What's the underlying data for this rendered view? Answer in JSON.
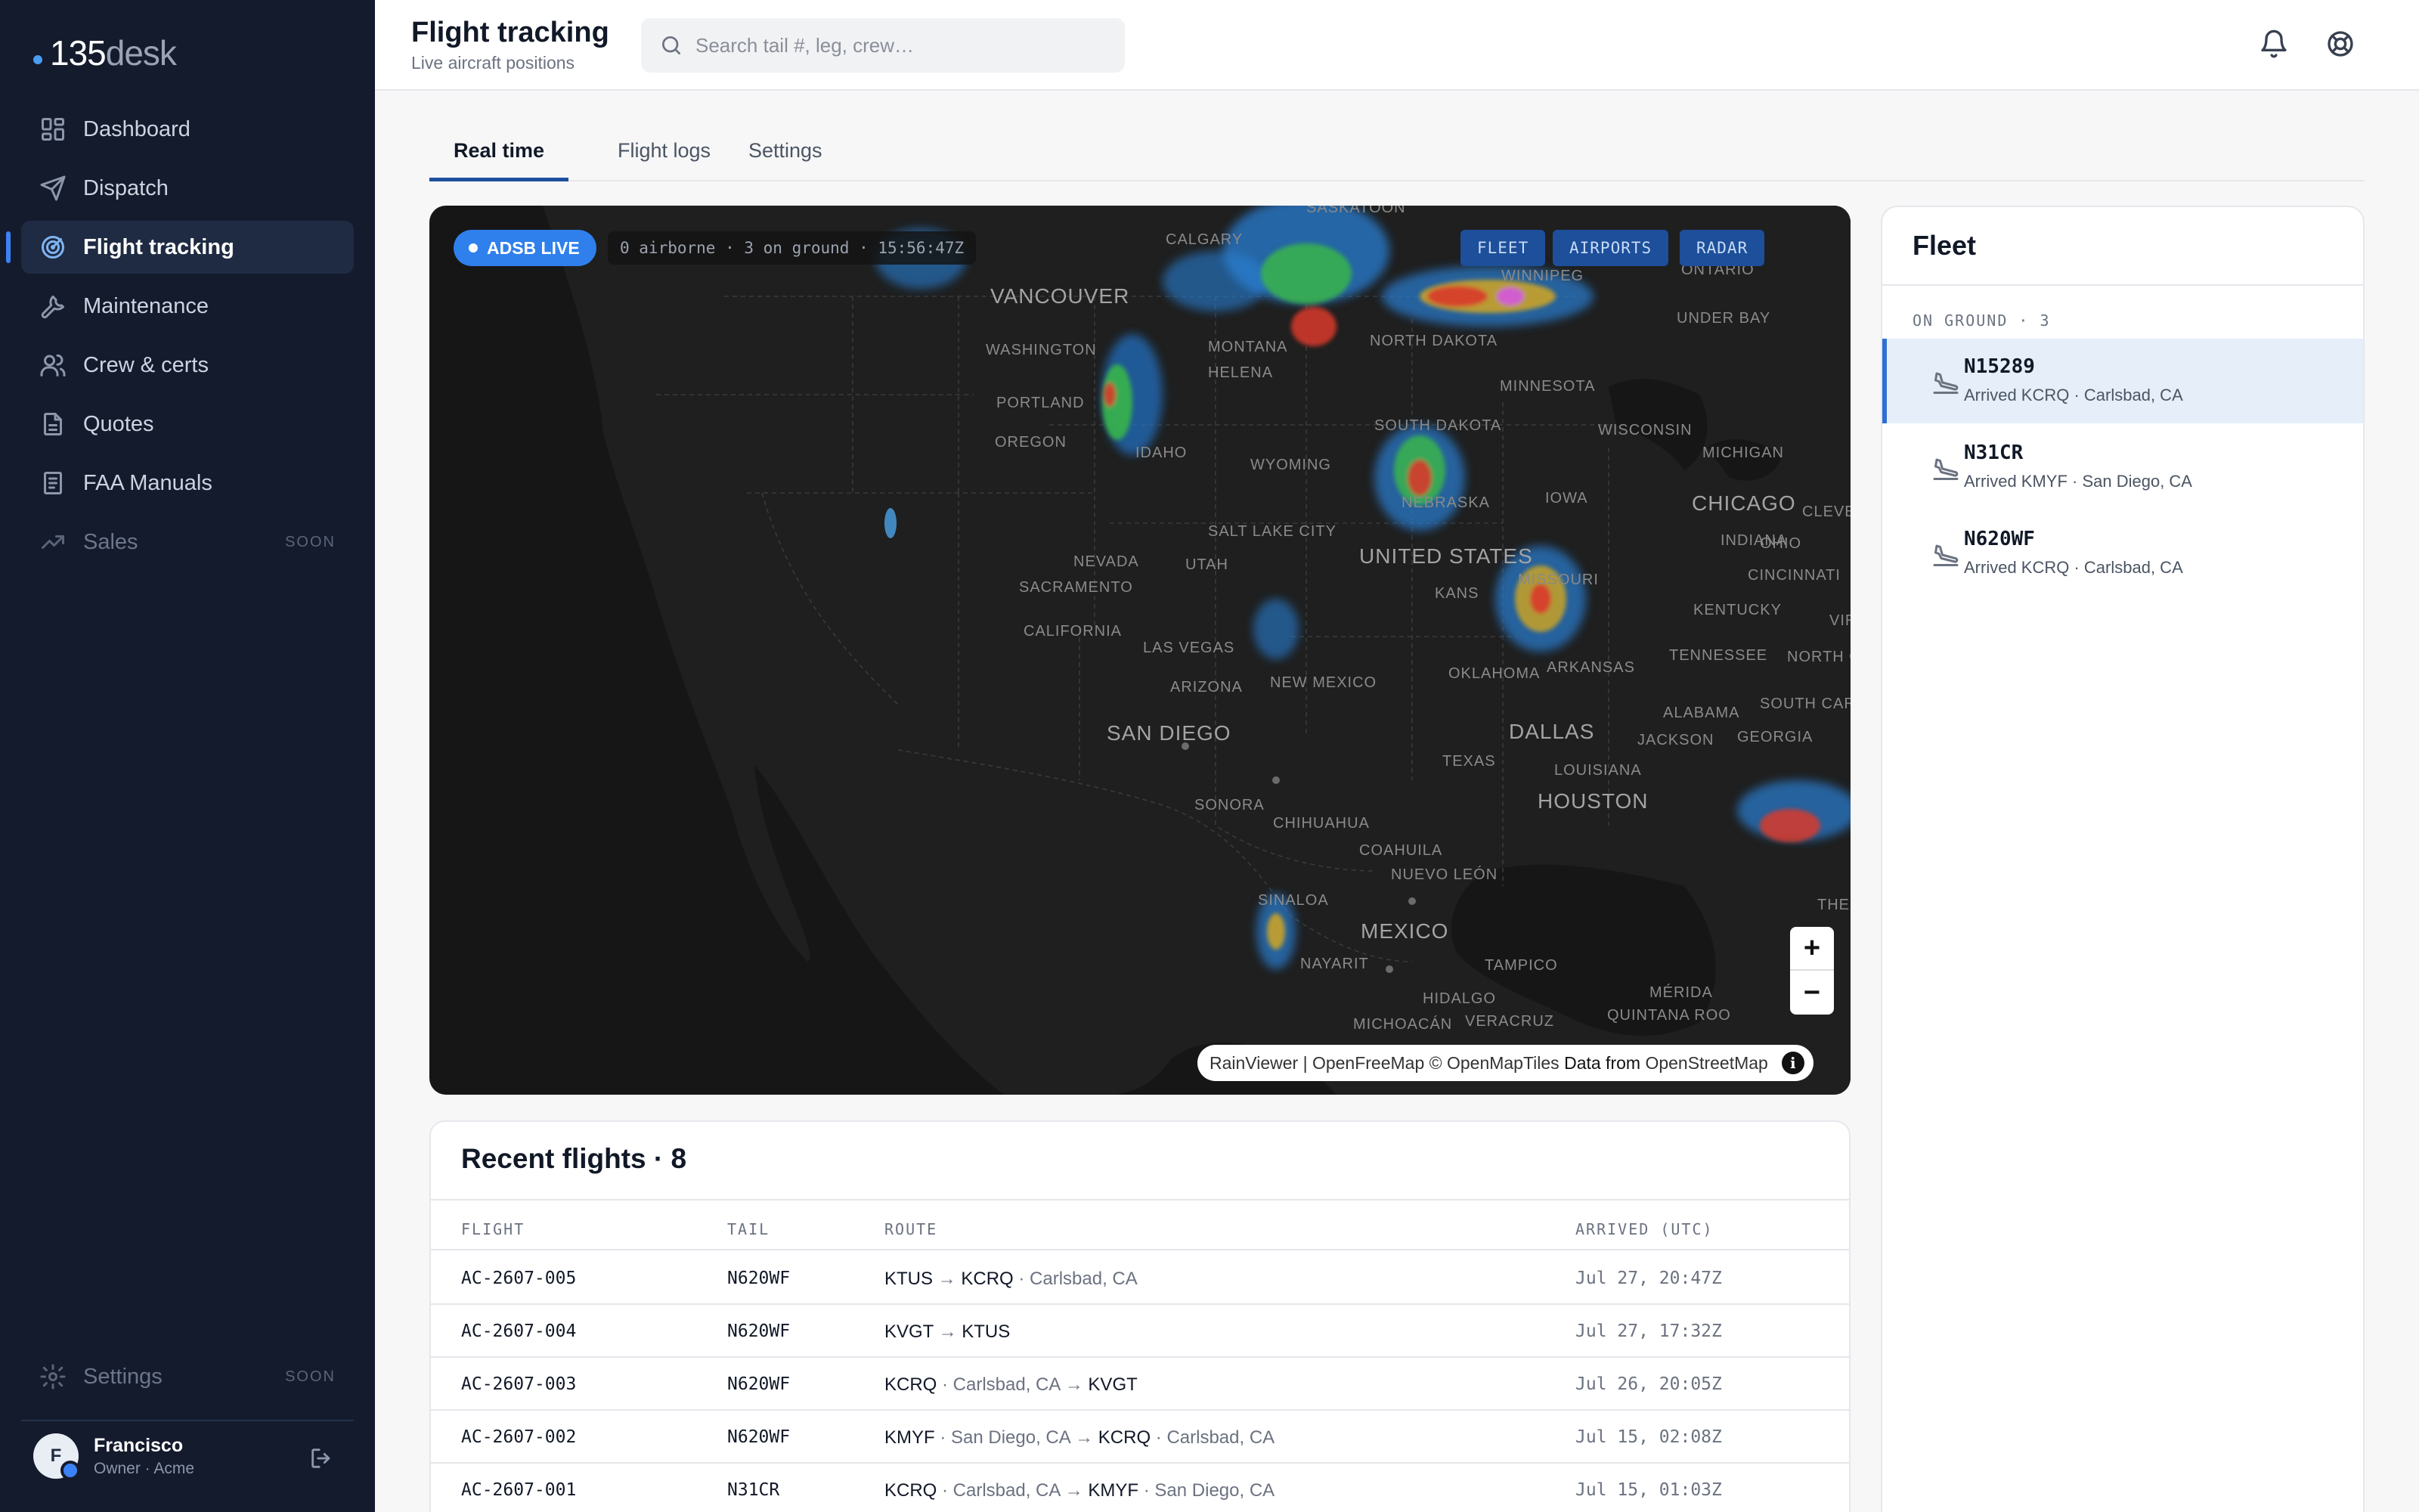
{
  "brand": {
    "number": "135",
    "word": "desk"
  },
  "sidebar": {
    "items": [
      {
        "label": "Dashboard"
      },
      {
        "label": "Dispatch"
      },
      {
        "label": "Flight tracking"
      },
      {
        "label": "Maintenance"
      },
      {
        "label": "Crew & certs"
      },
      {
        "label": "Quotes"
      },
      {
        "label": "FAA Manuals"
      },
      {
        "label": "Sales",
        "badge": "SOON"
      }
    ],
    "settings": {
      "label": "Settings",
      "badge": "SOON"
    },
    "user": {
      "initial": "F",
      "name": "Francisco",
      "role": "Owner · Acme"
    }
  },
  "header": {
    "title": "Flight tracking",
    "subtitle": "Live aircraft positions",
    "search_placeholder": "Search tail #, leg, crew…"
  },
  "tabs": [
    {
      "label": "Real time",
      "active": true
    },
    {
      "label": "Flight logs",
      "active": false
    },
    {
      "label": "Settings",
      "active": false
    }
  ],
  "map": {
    "live_label": "ADSB LIVE",
    "stats": "0 airborne · 3 on ground · 15:56:47Z",
    "layers": [
      "FLEET",
      "AIRPORTS",
      "RADAR"
    ],
    "zoom_in": "+",
    "zoom_out": "−",
    "attribution": {
      "sources": "RainViewer | OpenFreeMap © OpenMapTiles",
      "data_prefix": "Data from",
      "data_source": "OpenStreetMap",
      "info": "i"
    },
    "labels": {
      "saskatoon": "SASKATOON",
      "calgary": "CALGARY",
      "winnipeg": "WINNIPEG",
      "ontario": "ONTARIO",
      "vancouver": "VANCOUVER",
      "thunder_bay": "UNDER BAY",
      "washington": "WASHINGTON",
      "montana": "MONTANA",
      "helena": "HELENA",
      "north_dakota": "NORTH DAKOTA",
      "minnesota": "MINNESOTA",
      "portland": "PORTLAND",
      "oregon": "OREGON",
      "idaho": "IDAHO",
      "wyoming": "WYOMING",
      "south_dakota": "SOUTH DAKOTA",
      "wisconsin": "WISCONSIN",
      "michigan": "MICHIGAN",
      "nebraska": "NEBRASKA",
      "iowa": "IOWA",
      "chicago": "CHICAGO",
      "cleveland": "CLEVE",
      "salt_lake_city": "SALT LAKE CITY",
      "nevada": "NEVADA",
      "utah": "UTAH",
      "united_states": "UNITED STATES",
      "indiana": "INDIANA",
      "ohio": "OHIO",
      "sacramento": "SACRAMENTO",
      "kansas": "KANS",
      "missouri": "MISSOURI",
      "cincinnati": "CINCINNATI",
      "california": "CALIFORNIA",
      "kentucky": "KENTUCKY",
      "virginia": "VIR",
      "las_vegas": "LAS VEGAS",
      "arizona": "ARIZONA",
      "new_mexico": "NEW MEXICO",
      "oklahoma": "OKLAHOMA",
      "arkansas": "ARKANSAS",
      "tennessee": "TENNESSEE",
      "north_carolina": "NORTH C",
      "san_diego": "SAN DIEGO",
      "dallas": "DALLAS",
      "alabama": "ALABAMA",
      "jackson": "JACKSON",
      "south_carolina": "SOUTH CARO",
      "georgia": "GEORGIA",
      "texas": "TEXAS",
      "louisiana": "LOUISIANA",
      "houston": "HOUSTON",
      "sonora": "SONORA",
      "chihuahua": "CHIHUAHUA",
      "coahuila": "COAHUILA",
      "nuevo_leon": "NUEVO LEÓN",
      "sinaloa": "SINALOA",
      "mexico": "MEXICO",
      "the": "THE",
      "nayarit": "NAYARIT",
      "tampico": "TAMPICO",
      "hidalgo": "HIDALGO",
      "merida": "MÉRIDA",
      "michoacan": "MICHOACÁN",
      "veracruz": "VERACRUZ",
      "quintana_roo": "QUINTANA ROO"
    }
  },
  "flights": {
    "title": "Recent flights · 8",
    "columns": [
      "FLIGHT",
      "TAIL",
      "ROUTE",
      "ARRIVED (UTC)"
    ],
    "rows": [
      {
        "flight": "AC-2607-005",
        "tail": "N620WF",
        "from": "KTUS",
        "from_city": "",
        "to": "KCRQ",
        "to_city": "Carlsbad, CA",
        "arrived": "Jul 27, 20:47Z"
      },
      {
        "flight": "AC-2607-004",
        "tail": "N620WF",
        "from": "KVGT",
        "from_city": "",
        "to": "KTUS",
        "to_city": "",
        "arrived": "Jul 27, 17:32Z"
      },
      {
        "flight": "AC-2607-003",
        "tail": "N620WF",
        "from": "KCRQ",
        "from_city": "Carlsbad, CA",
        "to": "KVGT",
        "to_city": "",
        "arrived": "Jul 26, 20:05Z"
      },
      {
        "flight": "AC-2607-002",
        "tail": "N620WF",
        "from": "KMYF",
        "from_city": "San Diego, CA",
        "to": "KCRQ",
        "to_city": "Carlsbad, CA",
        "arrived": "Jul 15, 02:08Z"
      },
      {
        "flight": "AC-2607-001",
        "tail": "N31CR",
        "from": "KCRQ",
        "from_city": "Carlsbad, CA",
        "to": "KMYF",
        "to_city": "San Diego, CA",
        "arrived": "Jul 15, 01:03Z"
      }
    ]
  },
  "fleet": {
    "title": "Fleet",
    "section": "ON GROUND · 3",
    "items": [
      {
        "tail": "N15289",
        "status": "Arrived KCRQ · Carlsbad, CA",
        "selected": true
      },
      {
        "tail": "N31CR",
        "status": "Arrived KMYF · San Diego, CA",
        "selected": false
      },
      {
        "tail": "N620WF",
        "status": "Arrived KCRQ · Carlsbad, CA",
        "selected": false
      }
    ]
  },
  "colors": {
    "sidebar_bg": "#141b2d",
    "accent": "#2f80ed",
    "active_tab": "#1e4f9c",
    "map_bg": "#161616"
  },
  "icons": [
    "dashboard-icon",
    "dispatch-icon",
    "radar-icon",
    "wrench-icon",
    "users-icon",
    "document-icon",
    "manual-icon",
    "trending-icon",
    "gear-icon",
    "logout-icon",
    "search-icon",
    "bell-icon",
    "lifebuoy-icon",
    "plane-landing-icon"
  ]
}
